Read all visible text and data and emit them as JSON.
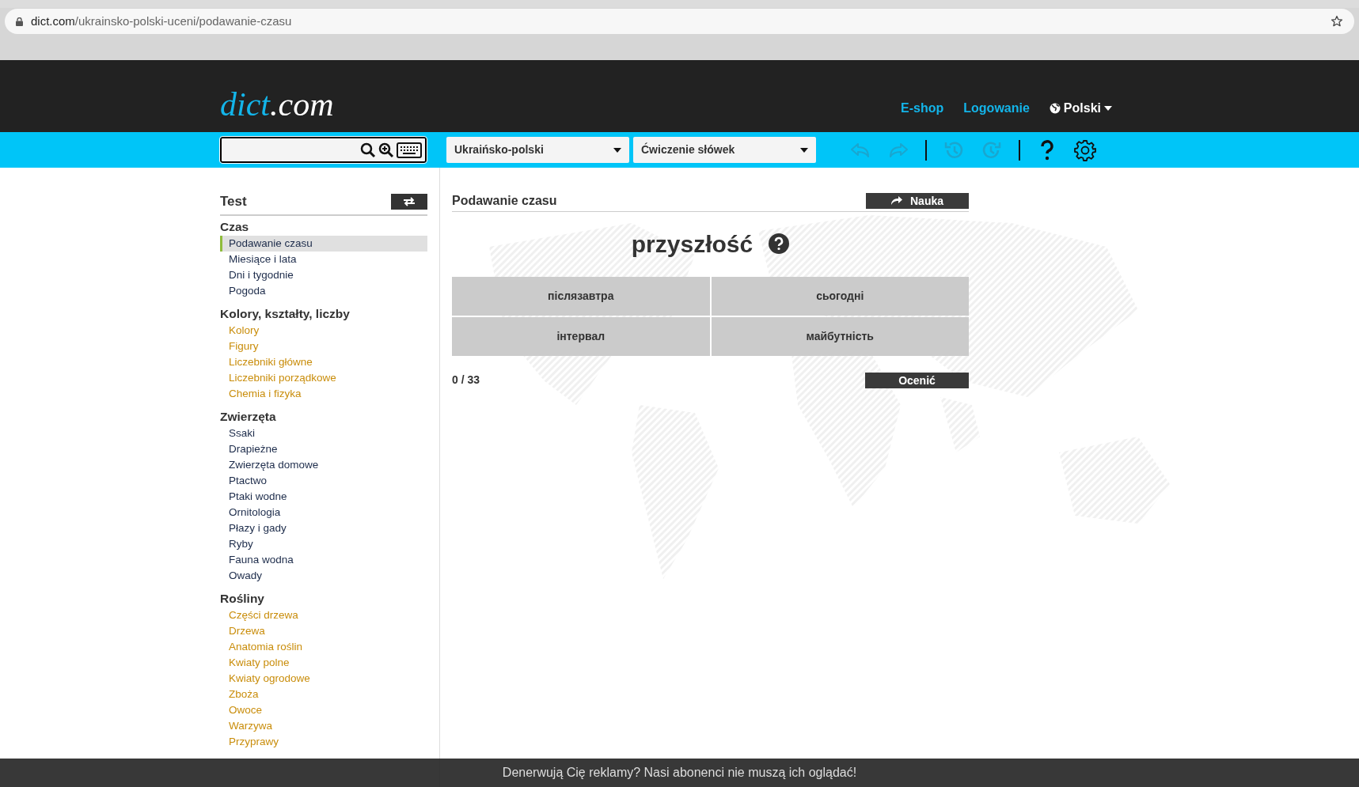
{
  "browser": {
    "url_host": "dict.com",
    "url_path": "/ukrainsko-polski-uceni/podawanie-czasu"
  },
  "header": {
    "logo_main": "dict",
    "logo_suffix": ".com",
    "links": [
      {
        "label": "E-shop"
      },
      {
        "label": "Logowanie"
      }
    ],
    "language": "Polski"
  },
  "toolbar": {
    "dropdowns": [
      {
        "value": "Ukraińsko-polski"
      },
      {
        "value": "Ćwiczenie słówek"
      }
    ],
    "buttons": [
      {
        "kind": "undo",
        "disabled": true
      },
      {
        "kind": "redo",
        "disabled": true
      },
      {
        "kind": "separator"
      },
      {
        "kind": "history-back",
        "disabled": true
      },
      {
        "kind": "history-forward",
        "disabled": true
      },
      {
        "kind": "separator"
      },
      {
        "kind": "help",
        "disabled": false
      },
      {
        "kind": "settings",
        "disabled": false
      }
    ]
  },
  "sidebar": {
    "title": "Test",
    "groups": [
      {
        "title": "Czas",
        "items": [
          {
            "label": "Podawanie czasu",
            "selected": true,
            "color": "#1c2b4a"
          },
          {
            "label": "Miesiące i lata",
            "selected": false,
            "color": "#1c2b4a"
          },
          {
            "label": "Dni i tygodnie",
            "selected": false,
            "color": "#1c2b4a"
          },
          {
            "label": "Pogoda",
            "selected": false,
            "color": "#1c2b4a"
          }
        ]
      },
      {
        "title": "Kolory, kształty, liczby",
        "items": [
          {
            "label": "Kolory",
            "selected": false,
            "color": "#c98d0b"
          },
          {
            "label": "Figury",
            "selected": false,
            "color": "#c98d0b"
          },
          {
            "label": "Liczebniki główne",
            "selected": false,
            "color": "#c98d0b"
          },
          {
            "label": "Liczebniki porządkowe",
            "selected": false,
            "color": "#c98d0b"
          },
          {
            "label": "Chemia i fizyka",
            "selected": false,
            "color": "#c98d0b"
          }
        ]
      },
      {
        "title": "Zwierzęta",
        "items": [
          {
            "label": "Ssaki",
            "selected": false,
            "color": "#1c2b4a"
          },
          {
            "label": "Drapieżne",
            "selected": false,
            "color": "#1c2b4a"
          },
          {
            "label": "Zwierzęta domowe",
            "selected": false,
            "color": "#1c2b4a"
          },
          {
            "label": "Ptactwo",
            "selected": false,
            "color": "#1c2b4a"
          },
          {
            "label": "Ptaki wodne",
            "selected": false,
            "color": "#1c2b4a"
          },
          {
            "label": "Ornitologia",
            "selected": false,
            "color": "#1c2b4a"
          },
          {
            "label": "Płazy i gady",
            "selected": false,
            "color": "#1c2b4a"
          },
          {
            "label": "Ryby",
            "selected": false,
            "color": "#1c2b4a"
          },
          {
            "label": "Fauna wodna",
            "selected": false,
            "color": "#1c2b4a"
          },
          {
            "label": "Owady",
            "selected": false,
            "color": "#1c2b4a"
          }
        ]
      },
      {
        "title": "Rośliny",
        "items": [
          {
            "label": "Części drzewa",
            "selected": false,
            "color": "#c98d0b"
          },
          {
            "label": "Drzewa",
            "selected": false,
            "color": "#c98d0b"
          },
          {
            "label": "Anatomia roślin",
            "selected": false,
            "color": "#c98d0b"
          },
          {
            "label": "Kwiaty polne",
            "selected": false,
            "color": "#c98d0b"
          },
          {
            "label": "Kwiaty ogrodowe",
            "selected": false,
            "color": "#c98d0b"
          },
          {
            "label": "Zboża",
            "selected": false,
            "color": "#c98d0b"
          },
          {
            "label": "Owoce",
            "selected": false,
            "color": "#c98d0b"
          },
          {
            "label": "Warzywa",
            "selected": false,
            "color": "#c98d0b"
          },
          {
            "label": "Przyprawy",
            "selected": false,
            "color": "#c98d0b"
          }
        ]
      }
    ]
  },
  "exercise": {
    "title": "Podawanie czasu",
    "study_button": "Nauka",
    "word": "przyszłość",
    "answers": [
      {
        "label": "післязавтра"
      },
      {
        "label": "сьогодні"
      },
      {
        "label": "інтервал"
      },
      {
        "label": "майбутність"
      }
    ],
    "progress": "0 / 33",
    "grade_button": "Ocenić"
  },
  "ad_bar": {
    "text": "Denerwują Cię reklamy? Nasi abonenci nie muszą ich oglądać!"
  }
}
